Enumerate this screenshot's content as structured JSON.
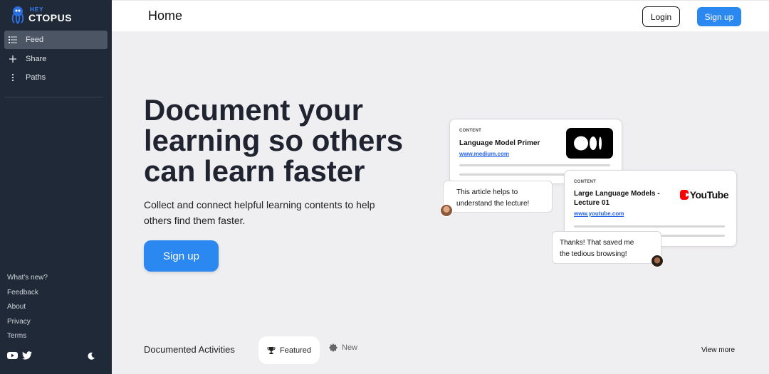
{
  "sidebar": {
    "logo": {
      "prefix": "HEY",
      "word": "CTOPUS"
    },
    "items": [
      {
        "label": "Feed",
        "icon": "list-icon",
        "active": true
      },
      {
        "label": "Share",
        "icon": "plus-icon",
        "active": false
      },
      {
        "label": "Paths",
        "icon": "dots-vertical-icon",
        "active": false
      }
    ],
    "footer_links": [
      "What's new?",
      "Feedback",
      "About",
      "Privacy",
      "Terms"
    ],
    "social_icons": [
      "youtube-icon",
      "twitter-icon"
    ],
    "theme_icon": "moon-icon"
  },
  "header": {
    "title": "Home",
    "login_label": "Login",
    "signup_label": "Sign up"
  },
  "hero": {
    "title_lines": [
      "Document your",
      "learning so others",
      "can learn faster"
    ],
    "subtitle_lines": [
      "Collect and connect helpful learning contents to help",
      "others find them faster."
    ],
    "signup_label": "Sign up"
  },
  "illustration": {
    "card1": {
      "tag": "CONTENT",
      "title": "Language Model Primer",
      "link": "www.medium.com",
      "logo": "medium-logo"
    },
    "card2": {
      "tag": "CONTENT",
      "title_lines": [
        "Large Language Models -",
        "Lecture 01"
      ],
      "link": "www.youtube.com",
      "logo_text": "YouTube"
    },
    "bubble1_lines": [
      "This article helps to",
      "understand the lecture!"
    ],
    "bubble2_lines": [
      "Thanks! That saved me",
      "the tedious browsing!"
    ]
  },
  "activities": {
    "title": "Documented Activities",
    "tabs": [
      {
        "label": "Featured",
        "icon": "trophy-icon",
        "selected": true
      },
      {
        "label": "New",
        "icon": "badge-icon",
        "selected": false
      }
    ],
    "view_more": "View more"
  },
  "colors": {
    "sidebar_bg": "#1f2937",
    "accent": "#2b88f0",
    "page_bg": "#efeef0"
  }
}
